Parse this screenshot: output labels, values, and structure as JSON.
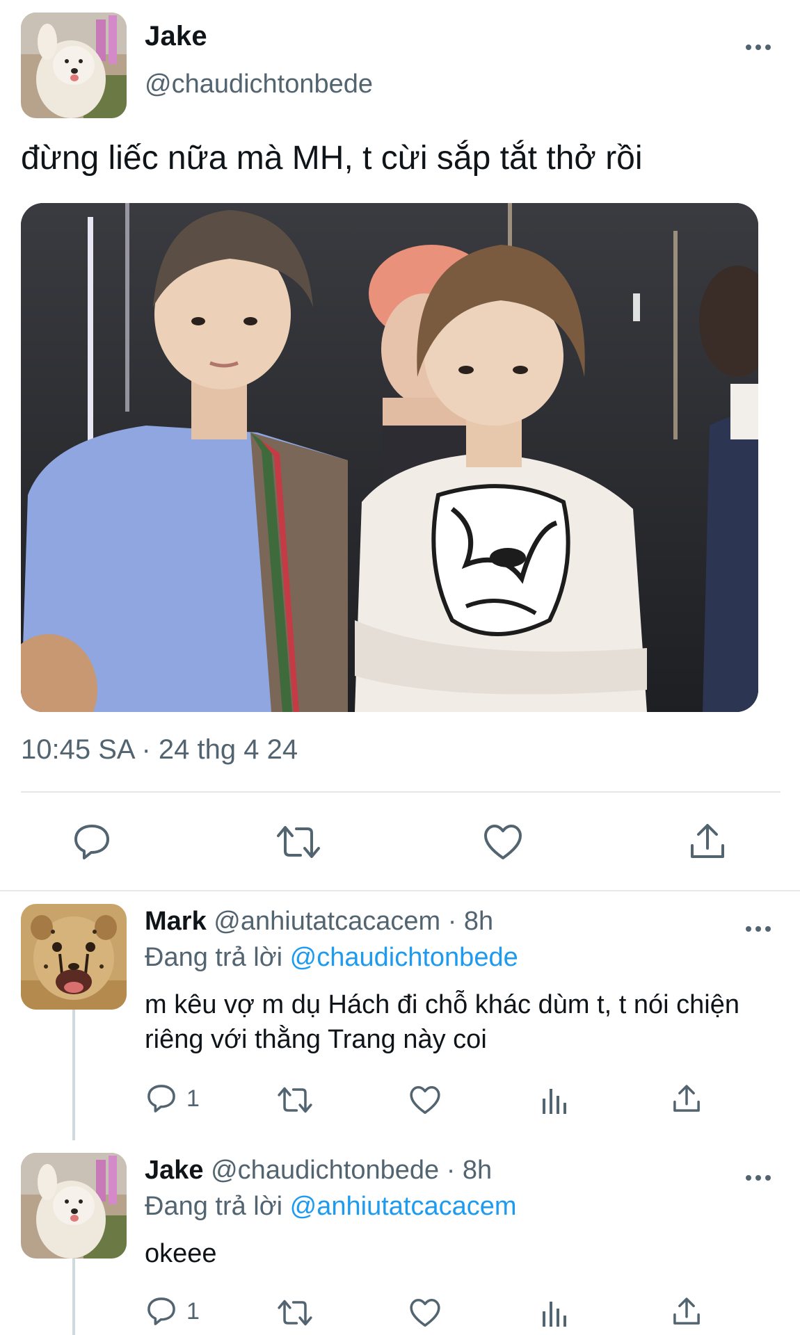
{
  "main_tweet": {
    "author_name": "Jake",
    "author_handle": "@chaudichtonbede",
    "text": "đừng liếc nữa mà MH, t cừi sắp tắt thở rồi",
    "timestamp": "10:45 SA · 24 thg 4 24",
    "actions": {
      "reply_icon": "speech-bubble",
      "retweet_icon": "retweet-arrows",
      "like_icon": "heart",
      "share_icon": "share-upload"
    }
  },
  "replies": [
    {
      "author_name": "Mark",
      "meta": "@anhiutatcacacem · 8h",
      "replying_prefix": "Đang trả lời",
      "replying_to": "@chaudichtonbede",
      "text": "m kêu vợ m dụ Hách đi chỗ khác dùm t, t nói chiện riêng với thằng Trang này coi",
      "reply_count": "1"
    },
    {
      "author_name": "Jake",
      "meta": "@chaudichtonbede · 8h",
      "replying_prefix": "Đang trả lời",
      "replying_to": "@anhiutatcacacem",
      "text": "okeee",
      "reply_count": "1"
    }
  ],
  "colors": {
    "text_primary": "#0f1419",
    "text_secondary": "#536471",
    "link": "#1d9bf0",
    "divider": "#e4e7ea"
  }
}
